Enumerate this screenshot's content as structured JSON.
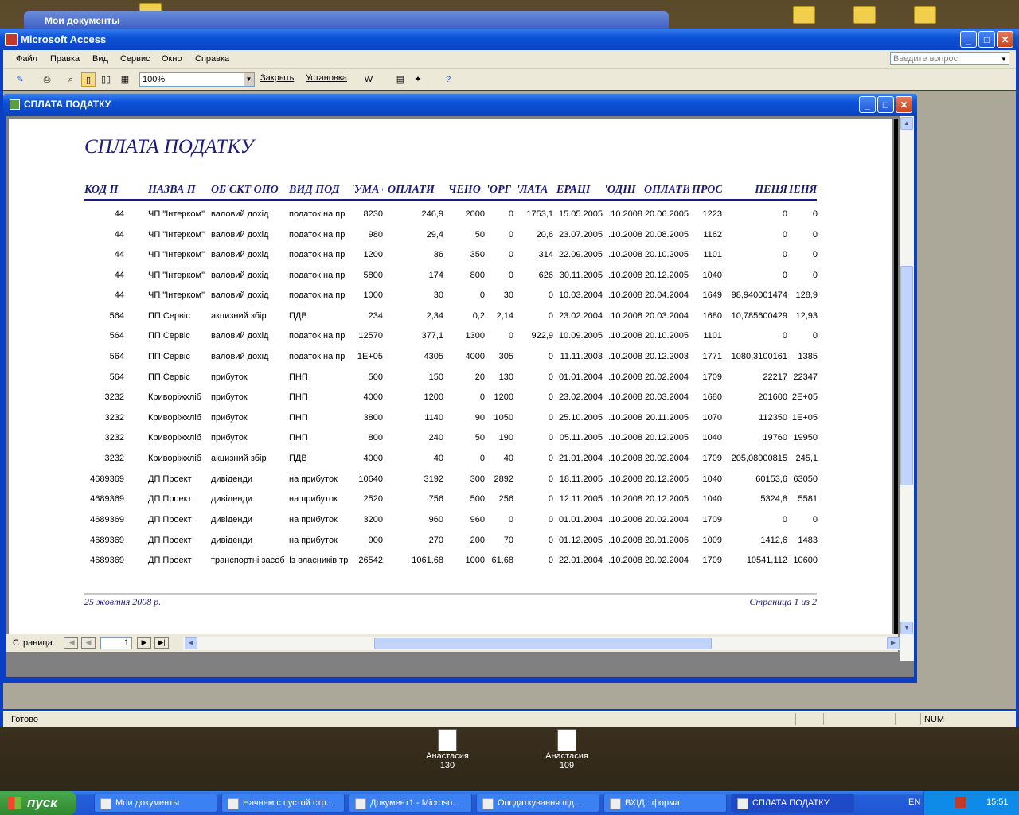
{
  "desktop": {
    "bg_window_title": "Мои документы",
    "icons": [
      {
        "label": "Анастасия\n130",
        "line1": "Анастасия",
        "line2": "130"
      },
      {
        "label": "Анастасия\n109",
        "line1": "Анастасия",
        "line2": "109"
      }
    ]
  },
  "app": {
    "title": "Microsoft Access",
    "menu": [
      "Файл",
      "Правка",
      "Вид",
      "Сервис",
      "Окно",
      "Справка"
    ],
    "ask_placeholder": "Введите вопрос",
    "zoom": "100%",
    "close_label": "Закрыть",
    "setup_label": "Установка",
    "status": "Готово",
    "num": "NUM"
  },
  "report": {
    "window_title": "СПЛАТА ПОДАТКУ",
    "title": "СПЛАТА ПОДАТКУ",
    "headers": [
      "КОД П",
      "НАЗВА П",
      "ОБ'ЄКТ ОПО",
      "ВИД ПОД",
      "'УМА О",
      "ОПЛАТИ",
      "ЧЕНО",
      "'ОРГ",
      "'ЛАТА",
      "ЕРАЦІ",
      "'ОДНІ",
      "ОПЛАТИ",
      "ПРОС",
      "ПЕНЯ",
      "ІЕНЯ"
    ],
    "rows": [
      [
        "44",
        "ЧП \"Інтерком\"",
        "валовий дохід",
        "податок на пр",
        "8230",
        "246,9",
        "2000",
        "0",
        "1753,1",
        "15.05.2005",
        ".10.2008",
        "20.06.2005",
        "1223",
        "0",
        "0"
      ],
      [
        "44",
        "ЧП \"Інтерком\"",
        "валовий дохід",
        "податок на пр",
        "980",
        "29,4",
        "50",
        "0",
        "20,6",
        "23.07.2005",
        ".10.2008",
        "20.08.2005",
        "1162",
        "0",
        "0"
      ],
      [
        "44",
        "ЧП \"Інтерком\"",
        "валовий дохід",
        "податок на пр",
        "1200",
        "36",
        "350",
        "0",
        "314",
        "22.09.2005",
        ".10.2008",
        "20.10.2005",
        "1101",
        "0",
        "0"
      ],
      [
        "44",
        "ЧП \"Інтерком\"",
        "валовий дохід",
        "податок на пр",
        "5800",
        "174",
        "800",
        "0",
        "626",
        "30.11.2005",
        ".10.2008",
        "20.12.2005",
        "1040",
        "0",
        "0"
      ],
      [
        "44",
        "ЧП \"Інтерком\"",
        "валовий дохід",
        "податок на пр",
        "1000",
        "30",
        "0",
        "30",
        "0",
        "10.03.2004",
        ".10.2008",
        "20.04.2004",
        "1649",
        "98,940001474",
        "128,9"
      ],
      [
        "564",
        "ПП Сервіс",
        "акцизний збір",
        "ПДВ",
        "234",
        "2,34",
        "0,2",
        "2,14",
        "0",
        "23.02.2004",
        ".10.2008",
        "20.03.2004",
        "1680",
        "10,785600429",
        "12,93"
      ],
      [
        "564",
        "ПП Сервіс",
        "валовий дохід",
        "податок на пр",
        "12570",
        "377,1",
        "1300",
        "0",
        "922,9",
        "10.09.2005",
        ".10.2008",
        "20.10.2005",
        "1101",
        "0",
        "0"
      ],
      [
        "564",
        "ПП Сервіс",
        "валовий дохід",
        "податок на пр",
        "1E+05",
        "4305",
        "4000",
        "305",
        "0",
        "11.11.2003",
        ".10.2008",
        "20.12.2003",
        "1771",
        "1080,3100161",
        "1385"
      ],
      [
        "564",
        "ПП Сервіс",
        "прибуток",
        "ПНП",
        "500",
        "150",
        "20",
        "130",
        "0",
        "01.01.2004",
        ".10.2008",
        "20.02.2004",
        "1709",
        "22217",
        "22347"
      ],
      [
        "3232",
        "Криворіжхліб",
        "прибуток",
        "ПНП",
        "4000",
        "1200",
        "0",
        "1200",
        "0",
        "23.02.2004",
        ".10.2008",
        "20.03.2004",
        "1680",
        "201600",
        "2E+05"
      ],
      [
        "3232",
        "Криворіжхліб",
        "прибуток",
        "ПНП",
        "3800",
        "1140",
        "90",
        "1050",
        "0",
        "25.10.2005",
        ".10.2008",
        "20.11.2005",
        "1070",
        "112350",
        "1E+05"
      ],
      [
        "3232",
        "Криворіжхліб",
        "прибуток",
        "ПНП",
        "800",
        "240",
        "50",
        "190",
        "0",
        "05.11.2005",
        ".10.2008",
        "20.12.2005",
        "1040",
        "19760",
        "19950"
      ],
      [
        "3232",
        "Криворіжхліб",
        "акцизний збір",
        "ПДВ",
        "4000",
        "40",
        "0",
        "40",
        "0",
        "21.01.2004",
        ".10.2008",
        "20.02.2004",
        "1709",
        "205,08000815",
        "245,1"
      ],
      [
        "4689369",
        "ДП Проект",
        "дивіденди",
        "на прибуток",
        "10640",
        "3192",
        "300",
        "2892",
        "0",
        "18.11.2005",
        ".10.2008",
        "20.12.2005",
        "1040",
        "60153,6",
        "63050"
      ],
      [
        "4689369",
        "ДП Проект",
        "дивіденди",
        "на прибуток",
        "2520",
        "756",
        "500",
        "256",
        "0",
        "12.11.2005",
        ".10.2008",
        "20.12.2005",
        "1040",
        "5324,8",
        "5581"
      ],
      [
        "4689369",
        "ДП Проект",
        "дивіденди",
        "на прибуток",
        "3200",
        "960",
        "960",
        "0",
        "0",
        "01.01.2004",
        ".10.2008",
        "20.02.2004",
        "1709",
        "0",
        "0"
      ],
      [
        "4689369",
        "ДП Проект",
        "дивіденди",
        "на прибуток",
        "900",
        "270",
        "200",
        "70",
        "0",
        "01.12.2005",
        ".10.2008",
        "20.01.2006",
        "1009",
        "1412,6",
        "1483"
      ],
      [
        "4689369",
        "ДП Проект",
        "транспортні засоб",
        "Із власників тр",
        "26542",
        "1061,68",
        "1000",
        "61,68",
        "0",
        "22.01.2004",
        ".10.2008",
        "20.02.2004",
        "1709",
        "10541,112",
        "10600"
      ]
    ],
    "footer_date": "25 жовтня 2008 р.",
    "footer_page": "Страница 1 из 2",
    "nav_label": "Страница:",
    "nav_page": "1"
  },
  "taskbar": {
    "start": "пуск",
    "tasks": [
      "Мои документы",
      "Начнем с пустой стр...",
      "Документ1 - Microso...",
      "Оподаткування під...",
      "ВХІД : форма",
      "СПЛАТА ПОДАТКУ"
    ],
    "lang": "EN",
    "time": "15:51"
  }
}
